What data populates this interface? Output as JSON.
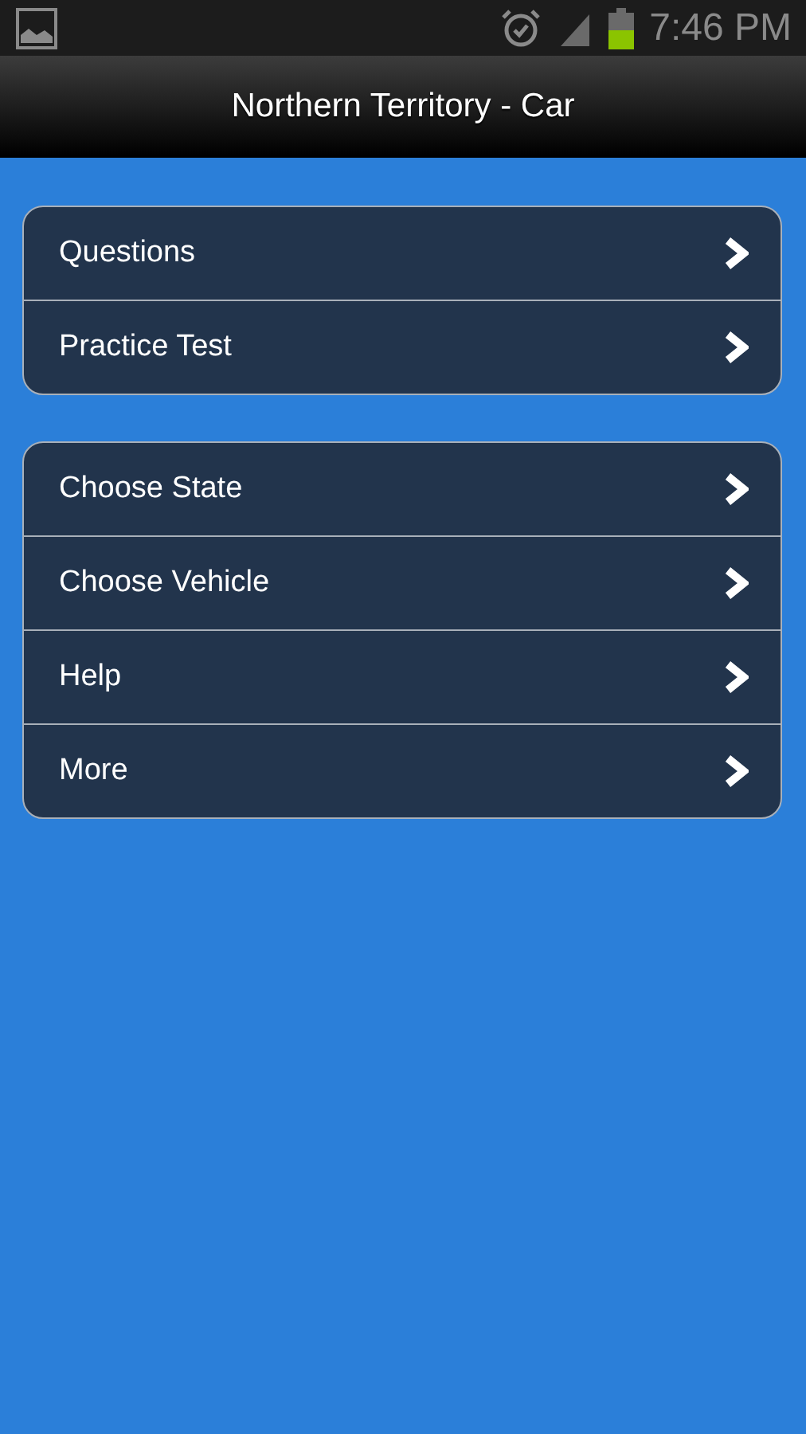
{
  "status_bar": {
    "time": "7:46 PM"
  },
  "header": {
    "title": "Northern Territory - Car"
  },
  "menu_groups": [
    {
      "items": [
        {
          "label": "Questions"
        },
        {
          "label": "Practice Test"
        }
      ]
    },
    {
      "items": [
        {
          "label": "Choose State"
        },
        {
          "label": "Choose Vehicle"
        },
        {
          "label": "Help"
        },
        {
          "label": "More"
        }
      ]
    }
  ]
}
